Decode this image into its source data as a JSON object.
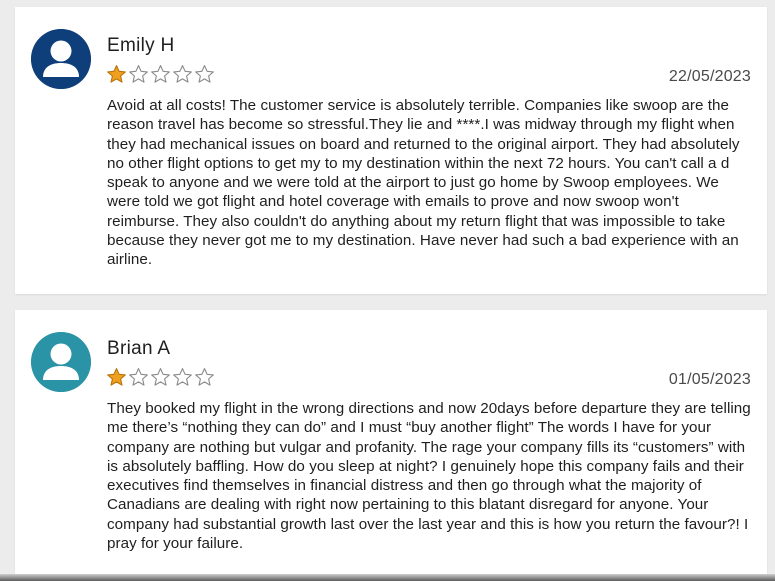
{
  "reviews": [
    {
      "author": "Emily H",
      "rating": 1,
      "max_rating": 5,
      "date": "22/05/2023",
      "avatar_color": "#0f3f7a",
      "avatar_icon": "user-icon",
      "text": "Avoid at all costs! The customer service is absolutely terrible. Companies like swoop are the reason travel has become so stressful.They lie and ****.I was midway through my flight when they had mechanical issues on board and returned to the original airport. They had absolutely no other flight options to get my to my destination within the next 72 hours. You can't call a d speak to anyone and we were told at the airport to just go home by Swoop employees. We were told we got flight and hotel coverage with emails to prove and now swoop won't reimburse. They also couldn't do anything about my return flight that was impossible to take because they never got me to my destination. Have never had such a bad experience with an airline."
    },
    {
      "author": "Brian A",
      "rating": 1,
      "max_rating": 5,
      "date": "01/05/2023",
      "avatar_color": "#2a93a6",
      "avatar_icon": "user-icon",
      "text": "They booked my flight in the wrong directions and now 20days before departure they are telling me there’s “nothing they can do” and I must “buy another flight” The words I have for your company are nothing but vulgar and profanity. The rage your company fills its “customers” with is absolutely baffling. How do you sleep at night? I genuinely hope this company fails and their executives find themselves in financial distress and then go through what the majority of Canadians are dealing with right now pertaining to this blatant disregard for anyone. Your company had substantial growth last over the last year and this is how you return the favour?! I pray for your failure."
    }
  ],
  "colors": {
    "star_filled": "#f0a020",
    "star_empty": "#8a8a8a"
  }
}
